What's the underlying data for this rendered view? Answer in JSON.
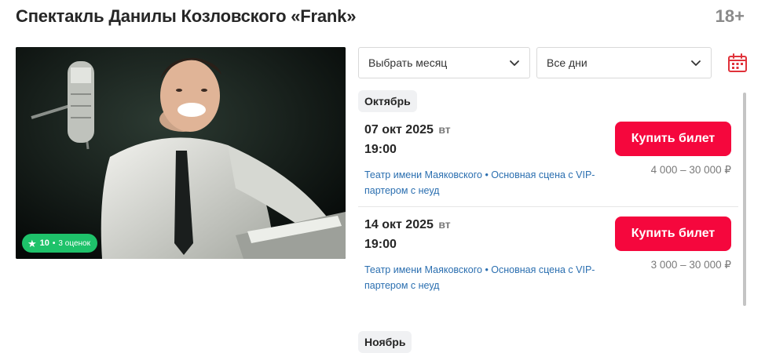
{
  "header": {
    "title": "Спектакль Данилы Козловского «Frank»",
    "age_rating": "18+"
  },
  "poster": {
    "rating": {
      "icon": "star-icon",
      "score": "10",
      "separator": "•",
      "count_label": "3 оценок",
      "color": "#1ec26a"
    }
  },
  "filters": {
    "month_select": {
      "value": "Выбрать месяц",
      "icon": "chevron-down-icon"
    },
    "days_select": {
      "value": "Все дни",
      "icon": "chevron-down-icon"
    },
    "calendar_button": {
      "icon": "calendar-icon",
      "color": "#e0323a"
    }
  },
  "schedule": {
    "months": [
      {
        "label": "Октябрь",
        "sessions": [
          {
            "date": "07 окт 2025",
            "weekday": "вт",
            "time": "19:00",
            "venue": "Театр имени Маяковского • Основная сцена с VIP-партером с неуд",
            "buy_label": "Купить билет",
            "price": "4 000 – 30 000 ₽"
          },
          {
            "date": "14 окт 2025",
            "weekday": "вт",
            "time": "19:00",
            "venue": "Театр имени Маяковского • Основная сцена с VIP-партером с неуд",
            "buy_label": "Купить билет",
            "price": "3 000 – 30 000 ₽"
          }
        ]
      },
      {
        "label": "Ноябрь",
        "sessions": []
      }
    ]
  },
  "colors": {
    "accent": "#f5073d",
    "link": "#2b6fb0",
    "muted": "#7a7a7a"
  }
}
